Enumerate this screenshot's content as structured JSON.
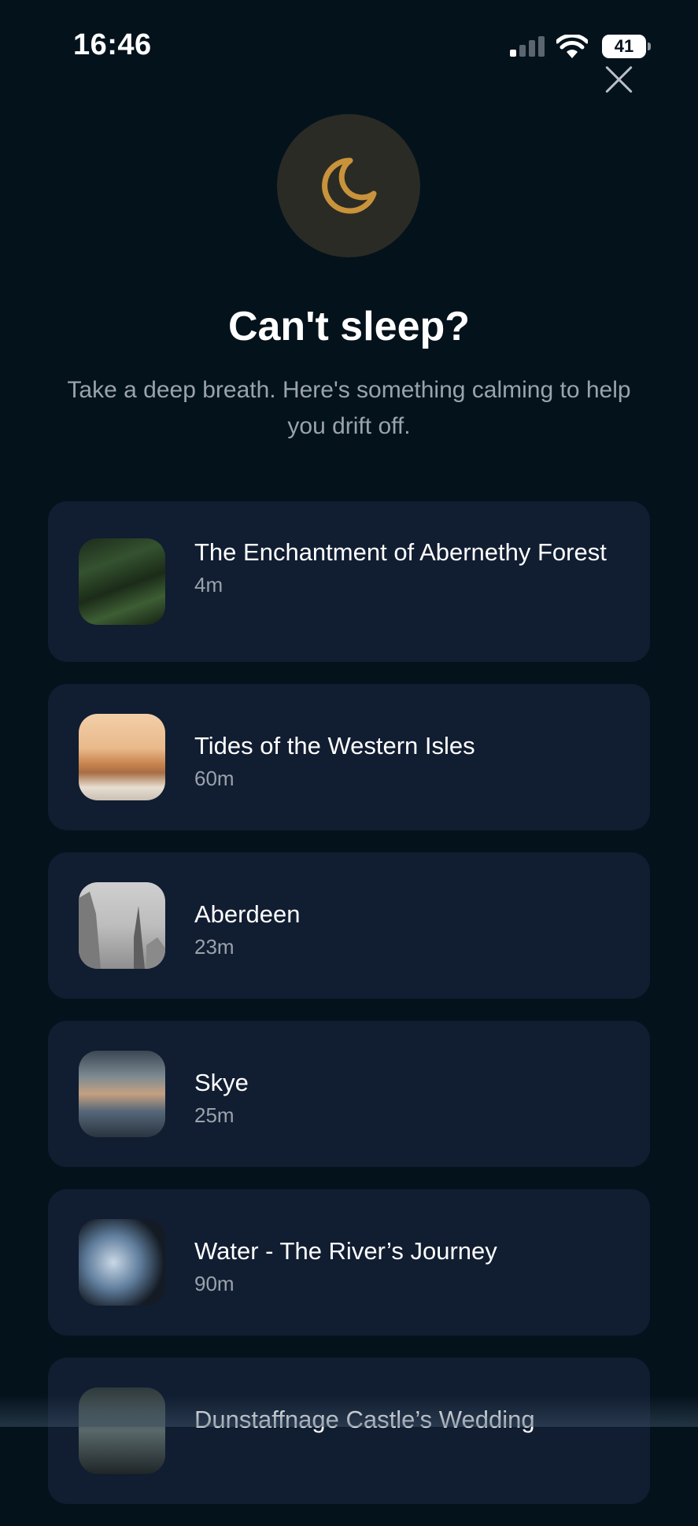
{
  "status_bar": {
    "time": "16:46",
    "battery_level": "41",
    "signal_bars_active": 1,
    "signal_bars_total": 4
  },
  "header": {
    "close_icon": "close-icon",
    "moon_icon": "moon-icon",
    "moon_color": "#c9933b",
    "title": "Can't sleep?",
    "subtitle": "Take a deep breath. Here's something calming to help you drift off."
  },
  "items": [
    {
      "title": "The Enchantment of Abernethy Forest",
      "duration": "4m",
      "thumbnail": "forest-thumbnail"
    },
    {
      "title": "Tides of the Western Isles",
      "duration": "60m",
      "thumbnail": "sunset-waves-thumbnail"
    },
    {
      "title": "Aberdeen",
      "duration": "23m",
      "thumbnail": "foggy-city-thumbnail"
    },
    {
      "title": "Skye",
      "duration": "25m",
      "thumbnail": "sunrays-landscape-thumbnail"
    },
    {
      "title": "Water - The River’s Journey",
      "duration": "90m",
      "thumbnail": "water-splash-thumbnail"
    },
    {
      "title": "Dunstaffnage Castle’s Wedding",
      "duration": "",
      "thumbnail": "person-thumbnail"
    }
  ],
  "colors": {
    "background": "#04121c",
    "card": "#111d31",
    "secondary_text": "#9aa3ab",
    "accent": "#c9933b"
  }
}
